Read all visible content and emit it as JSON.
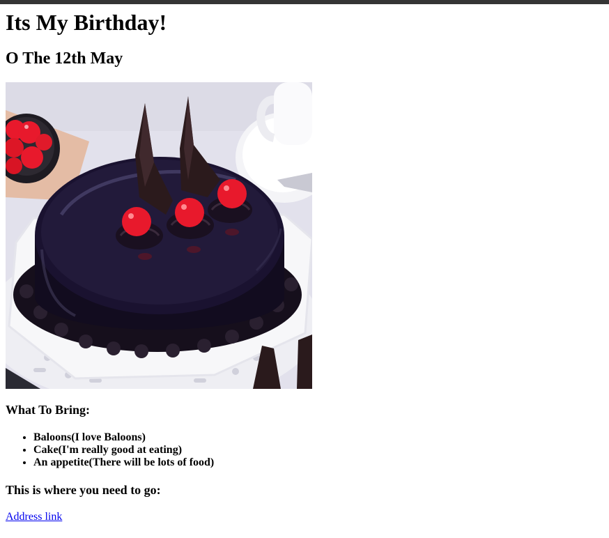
{
  "page": {
    "title": "Its My Birthday!",
    "date_heading": "O The 12th May",
    "image": {
      "alt": "Chocolate truffle cake with red cherries",
      "colors": {
        "background": "#e2e1ec",
        "glaze": "#120c1f",
        "cherry": "#e8192c"
      }
    },
    "bring_heading": "What To Bring:",
    "bring_items": [
      "Baloons(I love Baloons)",
      "Cake(I'm really good at eating)",
      "An appetite(There will be lots of food)"
    ],
    "go_heading": "This is where you need to go:",
    "address_link": "Address link"
  }
}
